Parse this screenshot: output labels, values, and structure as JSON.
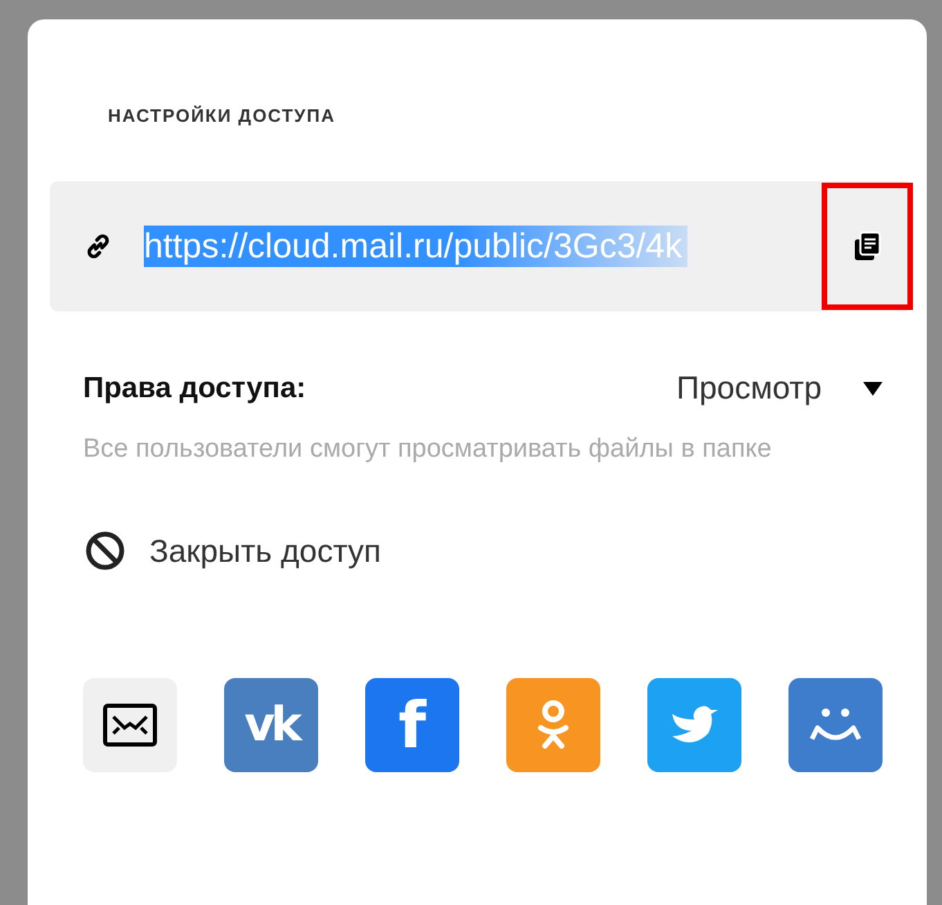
{
  "panel": {
    "title": "НАСТРОЙКИ ДОСТУПА",
    "link": {
      "value": "https://cloud.mail.ru/public/3Gc3/4k",
      "selected": true
    },
    "copy_button": {
      "highlighted": true
    },
    "access": {
      "label": "Права доступа:",
      "value": "Просмотр",
      "description": "Все пользователи смогут просматривать файлы в папке"
    },
    "close_access": {
      "label": "Закрыть доступ"
    },
    "share_buttons": [
      {
        "kind": "email",
        "color": "#f0f0f0"
      },
      {
        "kind": "vk",
        "color": "#4a7fbf",
        "glyph": "vk"
      },
      {
        "kind": "facebook",
        "color": "#1b76f0",
        "glyph": "f"
      },
      {
        "kind": "ok",
        "color": "#f79422"
      },
      {
        "kind": "twitter",
        "color": "#1da1f2"
      },
      {
        "kind": "agent",
        "color": "#3d7dcc"
      }
    ]
  }
}
